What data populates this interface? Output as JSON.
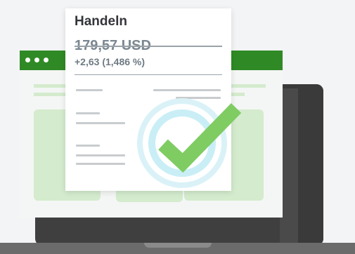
{
  "card": {
    "title": "Handeln",
    "price": "179,57 USD",
    "change": "+2,63 (1,486 %)"
  },
  "colors": {
    "browser_bar": "#2f8a25",
    "checkmark": "#7fcc63",
    "badge_ring": "#c9eef6",
    "laptop": "#3f3f3f"
  },
  "icons": {
    "badge": "checkmark-icon"
  }
}
